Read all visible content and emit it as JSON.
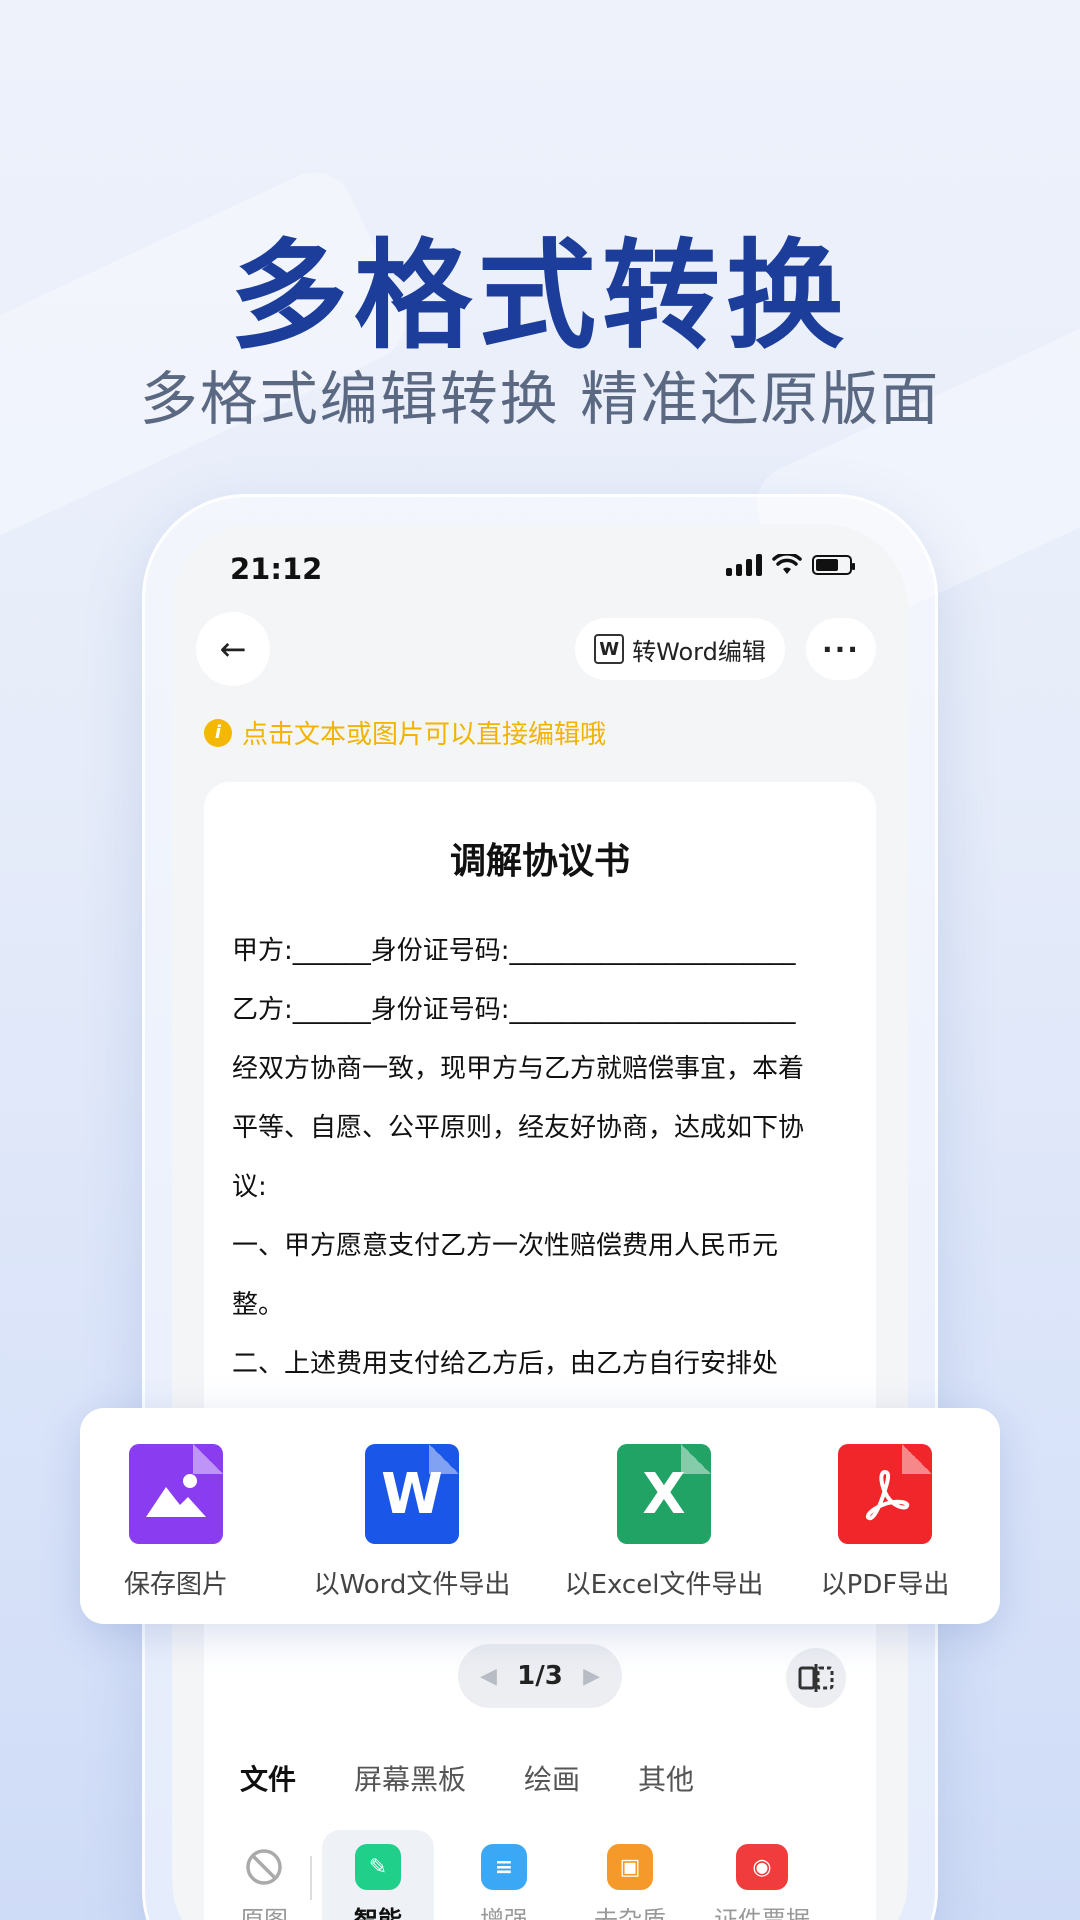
{
  "hero": {
    "title": "多格式转换",
    "subtitle": "多格式编辑转换  精准还原版面"
  },
  "status_bar": {
    "time": "21:12"
  },
  "toolbar": {
    "back_icon": "arrow-left-icon",
    "word_button_label": "转Word编辑",
    "more_icon": "more-dots-icon"
  },
  "tip": {
    "text": "点击文本或图片可以直接编辑哦",
    "color": "#f2b400"
  },
  "document": {
    "title": "调解协议书",
    "lines": [
      "甲方:______身份证号码:______________________",
      "乙方:______身份证号码:______________________",
      "经双方协商一致，现甲方与乙方就赔偿事宜，本着",
      "平等、自愿、公平原则，经友好协商，达成如下协",
      "议:",
      "一、甲方愿意支付乙方一次性赔偿费用人民币元",
      "整。",
      "二、上述费用支付给乙方后，由乙方自行安排处"
    ]
  },
  "export": {
    "items": [
      {
        "label": "保存图片",
        "icon": "image-file-icon",
        "color": "#8a3cf0"
      },
      {
        "label": "以Word文件导出",
        "icon": "word-file-icon",
        "color": "#1a56e8"
      },
      {
        "label": "以Excel文件导出",
        "icon": "excel-file-icon",
        "color": "#21a366"
      },
      {
        "label": "以PDF导出",
        "icon": "pdf-file-icon",
        "color": "#f0262b"
      }
    ]
  },
  "pager": {
    "text": "1/3"
  },
  "bottom": {
    "tabs": [
      "文件",
      "屏幕黑板",
      "绘画",
      "其他"
    ],
    "tools": [
      {
        "label": "原图",
        "icon": "original-icon"
      },
      {
        "label": "智能",
        "icon": "magic-wand-icon",
        "color": "#1fcf8a"
      },
      {
        "label": "增强",
        "icon": "sliders-icon",
        "color": "#3aa8f5"
      },
      {
        "label": "去杂质",
        "icon": "eraser-icon",
        "color": "#f59a2a"
      },
      {
        "label": "证件票据",
        "icon": "id-card-icon",
        "color": "#f03c3c"
      }
    ]
  }
}
